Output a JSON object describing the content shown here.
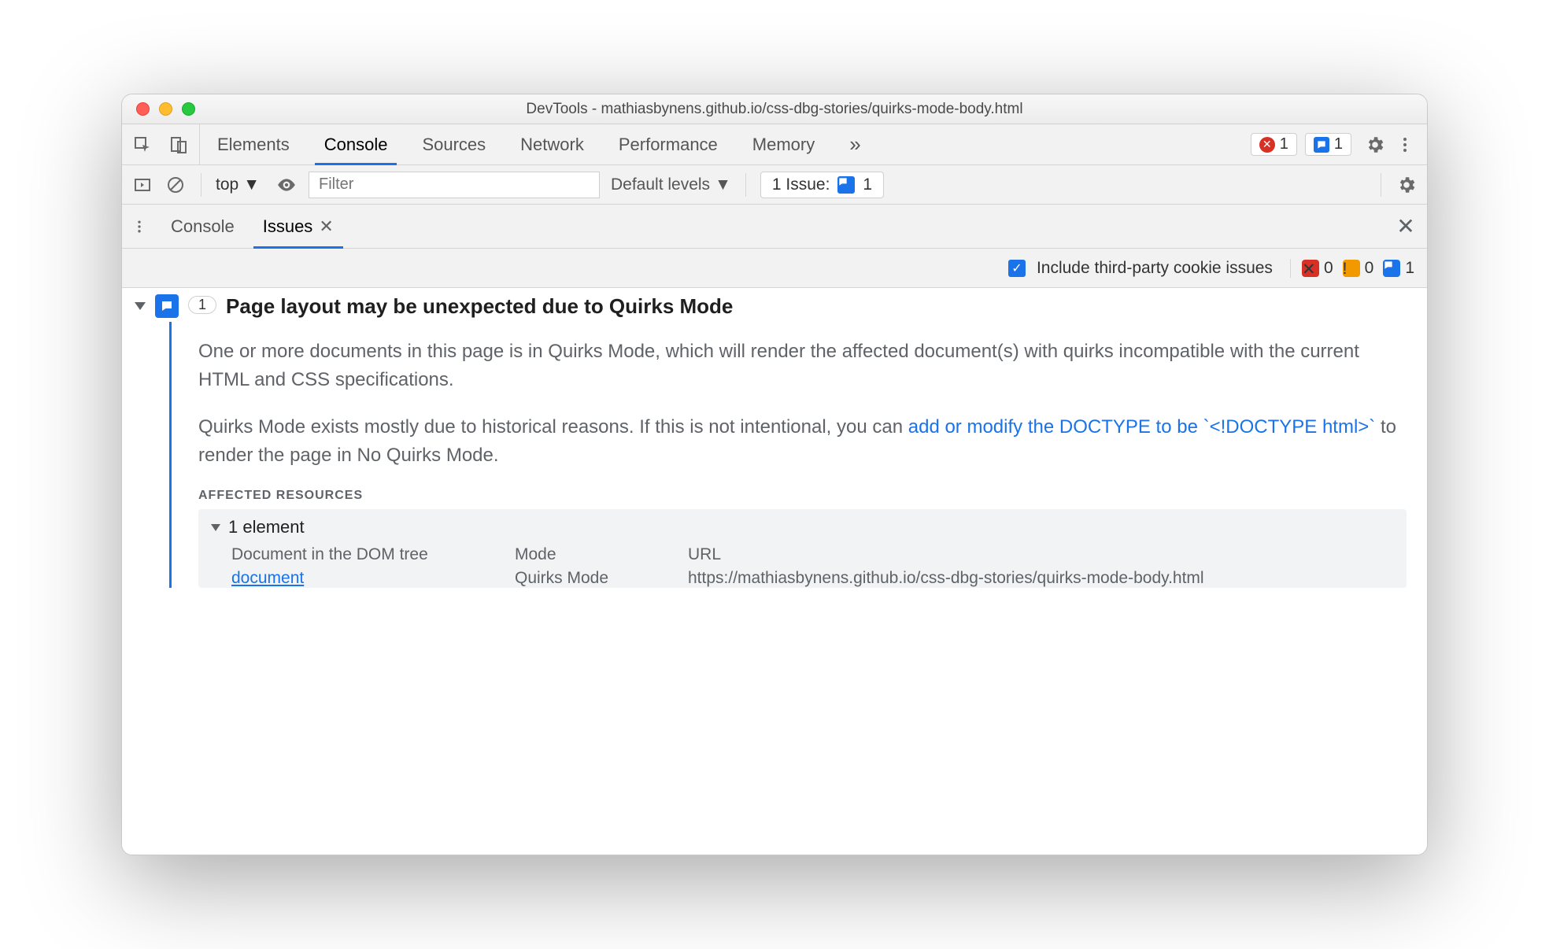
{
  "window": {
    "title": "DevTools - mathiasbynens.github.io/css-dbg-stories/quirks-mode-body.html"
  },
  "mainTabs": {
    "items": [
      "Elements",
      "Console",
      "Sources",
      "Network",
      "Performance",
      "Memory"
    ],
    "active": "Console",
    "overflow": "»"
  },
  "topRight": {
    "errors": "1",
    "info": "1"
  },
  "consoleBar": {
    "context": "top",
    "filterPlaceholder": "Filter",
    "levels": "Default levels",
    "issuePill": {
      "label": "1 Issue:",
      "count": "1"
    }
  },
  "drawer": {
    "tabs": {
      "console": "Console",
      "issues": "Issues"
    },
    "active": "Issues"
  },
  "issuesBar": {
    "checkboxLabel": "Include third-party cookie issues",
    "counts": {
      "errors": "0",
      "warnings": "0",
      "info": "1"
    }
  },
  "issue": {
    "count": "1",
    "title": "Page layout may be unexpected due to Quirks Mode",
    "p1": "One or more documents in this page is in Quirks Mode, which will render the affected document(s) with quirks incompatible with the current HTML and CSS specifications.",
    "p2a": "Quirks Mode exists mostly due to historical reasons. If this is not intentional, you can ",
    "p2link": "add or modify the DOCTYPE to be `<!DOCTYPE html>`",
    "p2b": " to render the page in No Quirks Mode.",
    "affectedLabel": "AFFECTED RESOURCES",
    "elementHeader": "1 element",
    "cols": {
      "doc": "Document in the DOM tree",
      "mode": "Mode",
      "url": "URL"
    },
    "row": {
      "doc": "document",
      "mode": "Quirks Mode",
      "url": "https://mathiasbynens.github.io/css-dbg-stories/quirks-mode-body.html"
    }
  }
}
